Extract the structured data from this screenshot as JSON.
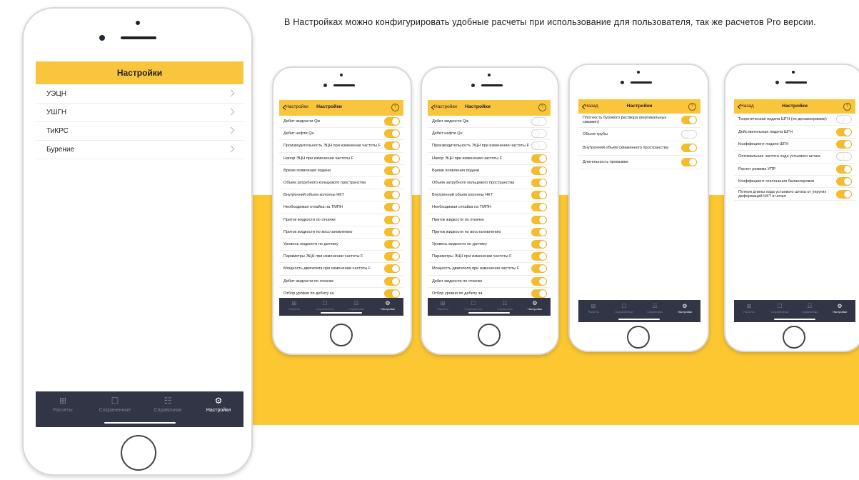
{
  "description": "В Настройках можно конфигурировать удобные расчеты при использование для пользователя, так же расчетов Pro версии.",
  "colors": {
    "accent": "#f9c53c",
    "band": "#fcc731",
    "tabbar": "#323546"
  },
  "big_phone": {
    "title": "Настройки",
    "items": [
      {
        "label": "УЭЦН"
      },
      {
        "label": "УШГН"
      },
      {
        "label": "ТиКРС"
      },
      {
        "label": "Бурение"
      }
    ]
  },
  "tabs": [
    {
      "label": "Расчеты",
      "icon": "calculator-icon"
    },
    {
      "label": "Сохраненные",
      "icon": "bookmark-icon"
    },
    {
      "label": "Справочник",
      "icon": "book-icon"
    },
    {
      "label": "Настройки",
      "icon": "gear-icon"
    }
  ],
  "phone1": {
    "back": "Настройки",
    "title": "Настройки",
    "help": "?",
    "rows": [
      {
        "label": "Дебит жидкости Qж",
        "on": true
      },
      {
        "label": "Дебит нефти Qн",
        "on": true
      },
      {
        "label": "Производительность ЭЦН при изменении частоты F",
        "on": true
      },
      {
        "label": "Напор ЭЦН при изменении частоты F",
        "on": true
      },
      {
        "label": "Время появления подачи",
        "on": true
      },
      {
        "label": "Объем затрубного кольцевого пространства",
        "on": true
      },
      {
        "label": "Внутренний объем колонны НКТ",
        "on": true
      },
      {
        "label": "Необходимая отпайка на ТМПН",
        "on": true
      },
      {
        "label": "Приток жидкости по откачке",
        "on": true
      },
      {
        "label": "Приток жидкости по восстановлению",
        "on": true
      },
      {
        "label": "Уровень жидкости по датчику",
        "on": true
      },
      {
        "label": "Параметры ЭЦН при изменении частоты F",
        "on": true
      },
      {
        "label": "Мощность двигателя при изменении частоты F",
        "on": true
      },
      {
        "label": "Дебит жидкости по откачке",
        "on": true
      },
      {
        "label": "Отбор уровня по дебиту за",
        "on": true
      }
    ]
  },
  "phone2": {
    "back": "Настройки",
    "title": "Настройки",
    "help": "?",
    "rows": [
      {
        "label": "Дебит жидкости Qж",
        "on": false
      },
      {
        "label": "Дебит нефти Qн",
        "on": false
      },
      {
        "label": "Производительность ЭЦН при изменении частоты F",
        "on": false
      },
      {
        "label": "Напор ЭЦН при изменении частоты F",
        "on": true
      },
      {
        "label": "Время появления подачи",
        "on": true
      },
      {
        "label": "Объем затрубного кольцевого пространства",
        "on": true
      },
      {
        "label": "Внутренний объем колонны НКТ",
        "on": true
      },
      {
        "label": "Необходимая отпайка на ТМПН",
        "on": true
      },
      {
        "label": "Приток жидкости по откачке",
        "on": true
      },
      {
        "label": "Приток жидкости по восстановлению",
        "on": true
      },
      {
        "label": "Уровень жидкости по датчику",
        "on": true
      },
      {
        "label": "Параметры ЭЦН при изменении частоты F",
        "on": true
      },
      {
        "label": "Мощность двигателя при изменении частоты F",
        "on": true
      },
      {
        "label": "Дебит жидкости по откачке",
        "on": true
      },
      {
        "label": "Отбор уровня по дебиту за",
        "on": true
      }
    ]
  },
  "phone3": {
    "back": "Назад",
    "title": "Настройки",
    "help": "?",
    "rows": [
      {
        "label": "Плотность бурового раствора (вертикальных скважин)",
        "on": true
      },
      {
        "label": "Объем трубы",
        "on": false
      },
      {
        "label": "Внутренний объем скважинного пространства",
        "on": true
      },
      {
        "label": "Длительность промывки",
        "on": true
      }
    ]
  },
  "phone4": {
    "back": "Назад",
    "title": "Настройки",
    "help": "?",
    "rows": [
      {
        "label": "Теоретическая подача ШГН (по динамограмме)",
        "on": false
      },
      {
        "label": "Действительная подача ШГН",
        "on": true
      },
      {
        "label": "Коэффициент подачи ШГН",
        "on": true
      },
      {
        "label": "Оптимальная частота хода устьевого штока",
        "on": false
      },
      {
        "label": "Расчет режима УПР",
        "on": true
      },
      {
        "label": "Коэффициент отклонения балансировки",
        "on": true
      },
      {
        "label": "Потери длины хода устьевого штока от упругих деформаций НКТ и штанг",
        "on": true
      }
    ]
  }
}
